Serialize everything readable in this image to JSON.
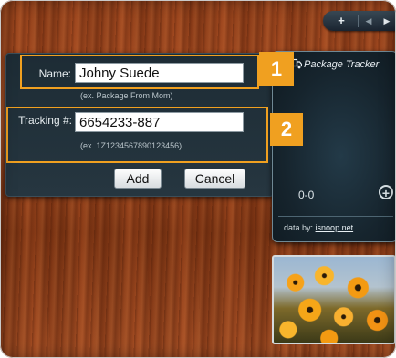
{
  "toolbar": {
    "add_glyph": "+",
    "prev_glyph": "◀",
    "next_glyph": "▶",
    "icons": [
      "plus-icon",
      "chevron-left-icon",
      "chevron-right-icon"
    ]
  },
  "dialog": {
    "name_label": "Name:",
    "name_value": "Johny Suede",
    "name_hint": "(ex. Package From Mom)",
    "tracking_label": "Tracking #:",
    "tracking_value": "6654233-887",
    "tracking_hint": "(ex. 1Z1234567890123456)",
    "add_label": "Add",
    "cancel_label": "Cancel"
  },
  "callouts": [
    {
      "number": "1"
    },
    {
      "number": "2"
    }
  ],
  "gadget": {
    "title": "Package Tracker",
    "count": "0-0",
    "add_glyph": "+",
    "credit_prefix": "data by:",
    "credit_link": "isnoop.net",
    "icon": "truck-icon"
  },
  "colors": {
    "callout": "#f0a020",
    "panel": "#1d2c35",
    "gadget": "#16242d"
  }
}
